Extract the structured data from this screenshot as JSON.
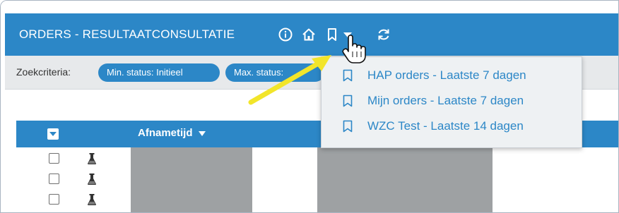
{
  "header": {
    "title": "ORDERS - RESULTAATCONSULTATIE",
    "icons": [
      "info-icon",
      "home-icon",
      "bookmark-icon",
      "caret-down-icon",
      "refresh-icon"
    ]
  },
  "criteria": {
    "label": "Zoekcriteria:",
    "pills": [
      "Min. status: Initieel",
      "Max. status: "
    ]
  },
  "table": {
    "sort_column": "Afnametijd",
    "sort_icon": "caret-down-icon",
    "row_icon": "flask-icon"
  },
  "bookmarks_menu": {
    "items": [
      "HAP orders - Laatste 7 dagen",
      "Mijn orders - Laatste 7 dagen",
      "WZC Test - Laatste 14 dagen"
    ]
  },
  "colors": {
    "accent": "#2c87c7",
    "criteria_bg": "#e7e9eb",
    "dropdown_bg": "#eef1f3",
    "annotation_arrow": "#f2e52a",
    "redacted": "#9ea1a3"
  }
}
